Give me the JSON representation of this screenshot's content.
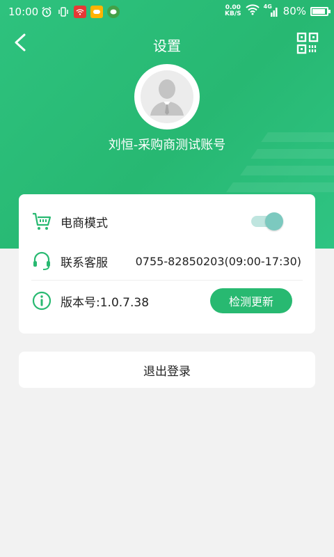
{
  "status_bar": {
    "time": "10:00",
    "net_speed_value": "0.00",
    "net_speed_unit": "KB/S",
    "network_type": "4G",
    "battery": "80%",
    "icons": [
      "alarm-icon",
      "vibrate-icon",
      "wifi-app-icon",
      "game-app-icon",
      "message-app-icon",
      "wifi-icon",
      "signal-icon",
      "battery-icon"
    ]
  },
  "header": {
    "title": "设置",
    "back_icon": "chevron-left-icon",
    "qr_icon": "qr-code-icon",
    "username": "刘恒-采购商测试账号"
  },
  "settings": {
    "ecommerce": {
      "label": "电商模式",
      "icon": "cart-icon",
      "enabled": true
    },
    "support": {
      "label": "联系客服",
      "icon": "headset-icon",
      "value": "0755-82850203(09:00-17:30)"
    },
    "version": {
      "label": "版本号:1.0.7.38",
      "icon": "info-icon",
      "button": "检测更新"
    }
  },
  "logout": {
    "label": "退出登录"
  },
  "colors": {
    "brand_green": "#28b971",
    "toggle_on": "#7cc9bf",
    "background": "#f2f2f2"
  }
}
